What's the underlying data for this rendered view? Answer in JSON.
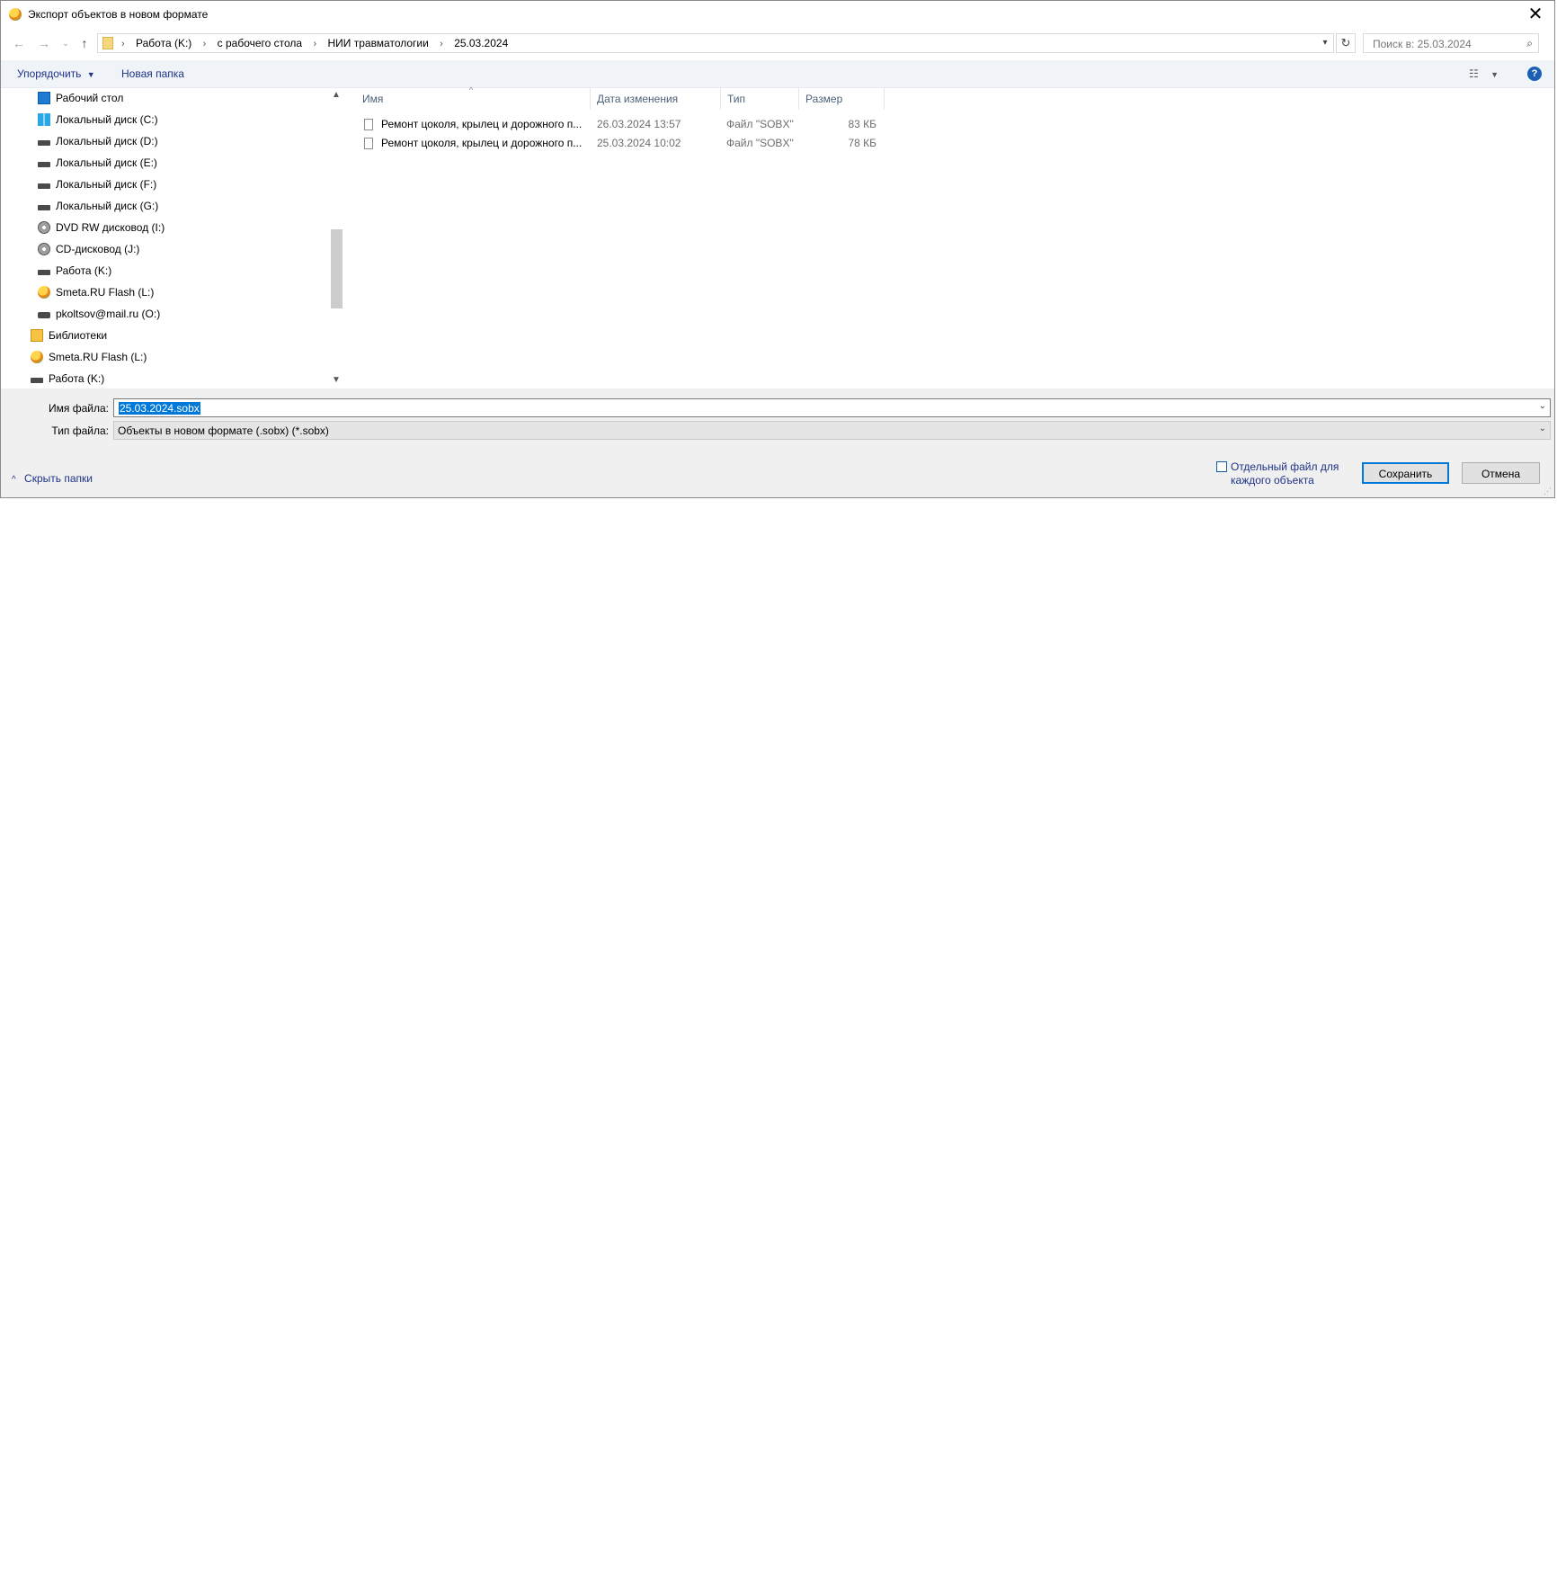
{
  "window": {
    "title": "Экспорт объектов в новом формате"
  },
  "address": {
    "crumbs": [
      "Работа (K:)",
      "с рабочего стола",
      "НИИ травматологии",
      "25.03.2024"
    ]
  },
  "search": {
    "placeholder": "Поиск в: 25.03.2024"
  },
  "toolbar": {
    "organize": "Упорядочить",
    "new_folder": "Новая папка"
  },
  "sidebar": {
    "items": [
      {
        "label": "Рабочий стол",
        "icon": "desktop-icon"
      },
      {
        "label": "Локальный диск (C:)",
        "icon": "windows-drive-icon"
      },
      {
        "label": "Локальный диск (D:)",
        "icon": "drive-icon"
      },
      {
        "label": "Локальный диск (E:)",
        "icon": "drive-icon"
      },
      {
        "label": "Локальный диск (F:)",
        "icon": "drive-icon"
      },
      {
        "label": "Локальный диск (G:)",
        "icon": "drive-icon"
      },
      {
        "label": "DVD RW дисковод (I:)",
        "icon": "disc-drive-icon"
      },
      {
        "label": "CD-дисковод (J:)",
        "icon": "disc-drive-icon"
      },
      {
        "label": "Работа (K:)",
        "icon": "drive-icon"
      },
      {
        "label": "Smeta.RU Flash (L:)",
        "icon": "smeta-icon"
      },
      {
        "label": "pkoltsov@mail.ru (O:)",
        "icon": "network-drive-icon"
      },
      {
        "label": "Библиотеки",
        "icon": "library-icon"
      },
      {
        "label": "Smeta.RU Flash (L:)",
        "icon": "smeta-icon"
      },
      {
        "label": "Работа (K:)",
        "icon": "drive-icon"
      }
    ]
  },
  "files": {
    "columns": {
      "name": "Имя",
      "date": "Дата изменения",
      "type": "Тип",
      "size": "Размер"
    },
    "rows": [
      {
        "name": "Ремонт цоколя, крылец и дорожного п...",
        "date": "26.03.2024 13:57",
        "type": "Файл \"SOBX\"",
        "size": "83 КБ"
      },
      {
        "name": "Ремонт цоколя, крылец и дорожного п...",
        "date": "25.03.2024 10:02",
        "type": "Файл \"SOBX\"",
        "size": "78 КБ"
      }
    ]
  },
  "form": {
    "filename_label": "Имя файла:",
    "filename_value": "25.03.2024.sobx",
    "filetype_label": "Тип файла:",
    "filetype_value": "Объекты в новом формате (.sobx) (*.sobx)"
  },
  "footer": {
    "hide_folders": "Скрыть папки",
    "separate_file_label": "Отдельный файл для каждого объекта",
    "save": "Сохранить",
    "cancel": "Отмена"
  }
}
